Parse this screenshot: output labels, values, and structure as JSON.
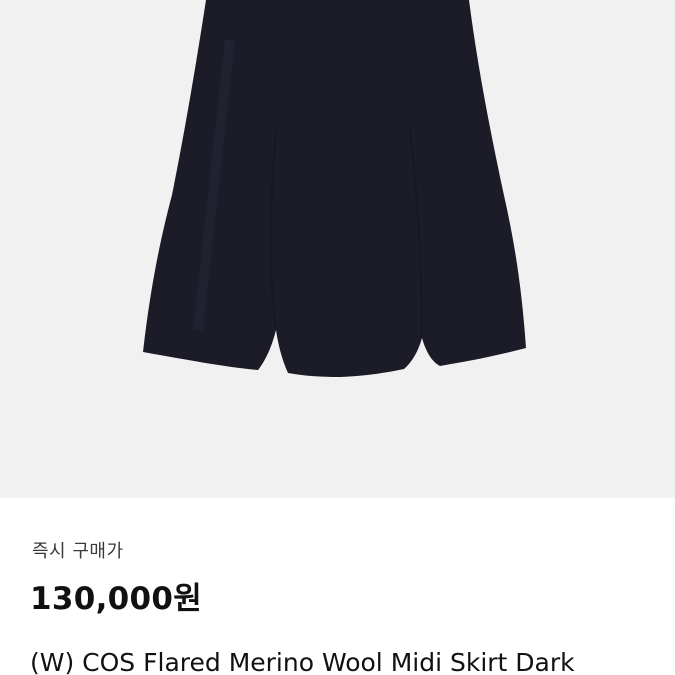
{
  "product": {
    "image_alt": "skirt-product-image",
    "price_label": "즉시 구매가",
    "price": "130,000원",
    "title": "(W) COS Flared Merino Wool Midi Skirt Dark"
  },
  "colors": {
    "image_background": "#f1f1f1",
    "skirt": "#1c1c29",
    "panel_background": "#ffffff",
    "text_primary": "#111111",
    "text_secondary": "#3a3a3a"
  }
}
